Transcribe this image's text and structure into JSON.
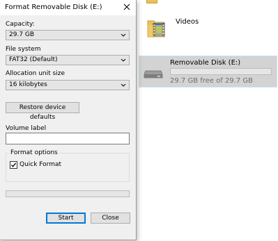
{
  "explorer": {
    "folder": {
      "label": "Videos",
      "icon": "videos-folder-icon"
    },
    "drive": {
      "name": "Removable Disk (E:)",
      "free_text": "29.7 GB free of 29.7 GB",
      "used_fraction": 0.0,
      "icon": "removable-drive-icon"
    }
  },
  "dialog": {
    "title": "Format Removable Disk (E:)",
    "capacity": {
      "label": "Capacity:",
      "value": "29.7 GB"
    },
    "file_system": {
      "label": "File system",
      "value": "FAT32 (Default)"
    },
    "allocation": {
      "label": "Allocation unit size",
      "value": "16 kilobytes"
    },
    "restore_label": "Restore device defaults",
    "volume_label": {
      "label": "Volume label",
      "value": ""
    },
    "format_options": {
      "legend": "Format options",
      "quick_format_label": "Quick Format",
      "quick_format_checked": true
    },
    "progress_fraction": 0.0,
    "start_label": "Start",
    "close_label": "Close"
  },
  "colors": {
    "dialog_bg": "#f0f0f0",
    "primary_border": "#0078d7",
    "selection_bg": "#d3d3d3"
  }
}
